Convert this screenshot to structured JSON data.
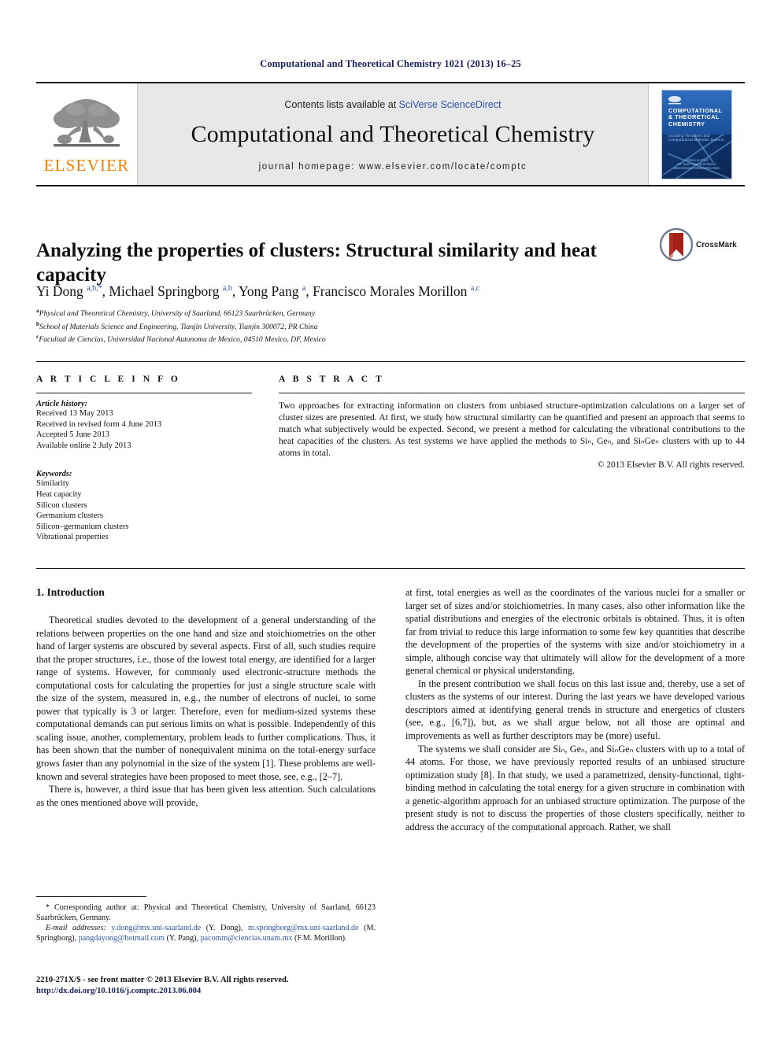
{
  "running_head": "Computational and Theoretical Chemistry 1021 (2013) 16–25",
  "masthead": {
    "publisher_name": "ELSEVIER",
    "contents_prefix": "Contents lists available at ",
    "contents_link": "SciVerse ScienceDirect",
    "journal_title": "Computational and Theoretical Chemistry",
    "journal_homepage": "journal homepage: www.elsevier.com/locate/comptc",
    "cover": {
      "title_line1": "COMPUTATIONAL",
      "title_line2": "& THEORETICAL",
      "title_line3": "CHEMISTRY",
      "subtitle": "Including Theochem and Computational Materials Science",
      "footer_line1": "Editors-in-Chief",
      "footer_line2": "Se-Yuan Chen and Manuel",
      "footer_line3": "www.elsevier.com/locate/comptc"
    }
  },
  "article": {
    "title": "Analyzing the properties of clusters: Structural similarity and heat capacity",
    "crossmark_label": "CrossMark",
    "authors_html": "Yi Dong <sup>a,b,*</sup>, Michael Springborg <sup>a,b</sup>, Yong Pang <sup>a</sup>, Francisco Morales Morillon <sup>a,c</sup>",
    "affiliations": [
      {
        "mark": "a",
        "text": "Physical and Theoretical Chemistry, University of Saarland, 66123 Saarbrücken, Germany"
      },
      {
        "mark": "b",
        "text": "School of Materials Science and Engineering, Tianjin University, Tianjin 300072, PR China"
      },
      {
        "mark": "c",
        "text": "Facultad de Ciencias, Universidad Nacional Autonoma de Mexico, 04510 Mexico, DF, Mexico"
      }
    ]
  },
  "article_info": {
    "heading": "A R T I C L E    I N F O",
    "history_label": "Article history:",
    "history": [
      "Received 13 May 2013",
      "Received in revised form 4 June 2013",
      "Accepted 5 June 2013",
      "Available online 2 July 2013"
    ],
    "keywords_label": "Keywords:",
    "keywords": [
      "Similarity",
      "Heat capacity",
      "Silicon clusters",
      "Germanium clusters",
      "Silicon–germanium clusters",
      "Vibrational properties"
    ]
  },
  "abstract": {
    "heading": "A B S T R A C T",
    "body": "Two approaches for extracting information on clusters from unbiased structure-optimization calculations on a larger set of cluster sizes are presented. At first, we study how structural similarity can be quantified and present an approach that seems to match what subjectively would be expected. Second, we present a method for calculating the vibrational contributions to the heat capacities of the clusters. As test systems we have applied the methods to Siₙ, Geₙ, and SiₙGeₙ clusters with up to 44 atoms in total.",
    "copyright": "© 2013 Elsevier B.V. All rights reserved."
  },
  "body": {
    "section_title": "1. Introduction",
    "left_paragraphs": [
      "Theoretical studies devoted to the development of a general understanding of the relations between properties on the one hand and size and stoichiometries on the other hand of larger systems are obscured by several aspects. First of all, such studies require that the proper structures, i.e., those of the lowest total energy, are identified for a larger range of systems. However, for commonly used electronic-structure methods the computational costs for calculating the properties for just a single structure scale with the size of the system, measured in, e.g., the number of electrons of nuclei, to some power that typically is 3 or larger. Therefore, even for medium-sized systems these computational demands can put serious limits on what is possible. Independently of this scaling issue, another, complementary, problem leads to further complications. Thus, it has been shown that the number of nonequivalent minima on the total-energy surface grows faster than any polynomial in the size of the system [1]. These problems are well-known and several strategies have been proposed to meet those, see, e.g., [2–7].",
      "There is, however, a third issue that has been given less attention. Such calculations as the ones mentioned above will provide,"
    ],
    "right_paragraphs": [
      "at first, total energies as well as the coordinates of the various nuclei for a smaller or larger set of sizes and/or stoichiometries. In many cases, also other information like the spatial distributions and energies of the electronic orbitals is obtained. Thus, it is often far from trivial to reduce this large information to some few key quantities that describe the development of the properties of the systems with size and/or stoichiometry in a simple, although concise way that ultimately will allow for the development of a more general chemical or physical understanding.",
      "In the present contribution we shall focus on this last issue and, thereby, use a set of clusters as the systems of our interest. During the last years we have developed various descriptors aimed at identifying general trends in structure and energetics of clusters (see, e.g., [6,7]), but, as we shall argue below, not all those are optimal and improvements as well as further descriptors may be (more) useful.",
      "The systems we shall consider are Siₙ, Geₙ, and SiₙGeₙ clusters with up to a total of 44 atoms. For those, we have previously reported results of an unbiased structure optimization study [8]. In that study, we used a parametrized, density-functional, tight-binding method in calculating the total energy for a given structure in combination with a genetic-algorithm approach for an unbiased structure optimization. The purpose of the present study is not to discuss the properties of those clusters specifically, neither to address the accuracy of the computational approach. Rather, we shall"
    ]
  },
  "footnotes": {
    "corresponding": "* Corresponding author at: Physical and Theoretical Chemistry, University of Saarland, 66123 Saarbrücken, Germany.",
    "email_label": "E-mail addresses:",
    "emails": [
      {
        "address": "y.dong@mx.uni-saarland.de",
        "owner": "(Y. Dong)"
      },
      {
        "address": "m.springborg@mx.uni-saarland.de",
        "owner": "(M. Springborg)"
      },
      {
        "address": "pangdayong@hotmail.com",
        "owner": "(Y. Pang)"
      },
      {
        "address": "pacomm@ciencias.unam.mx",
        "owner": "(F.M. Morillon)"
      }
    ]
  },
  "imprint": {
    "line1": "2210-271X/$ - see front matter © 2013 Elsevier B.V. All rights reserved.",
    "doi": "http://dx.doi.org/10.1016/j.comptc.2013.06.004"
  },
  "colors": {
    "link_blue": "#2c54a8",
    "header_navy": "#17205e",
    "elsevier_orange": "#f08000",
    "crossmark_red": "#a32118"
  }
}
